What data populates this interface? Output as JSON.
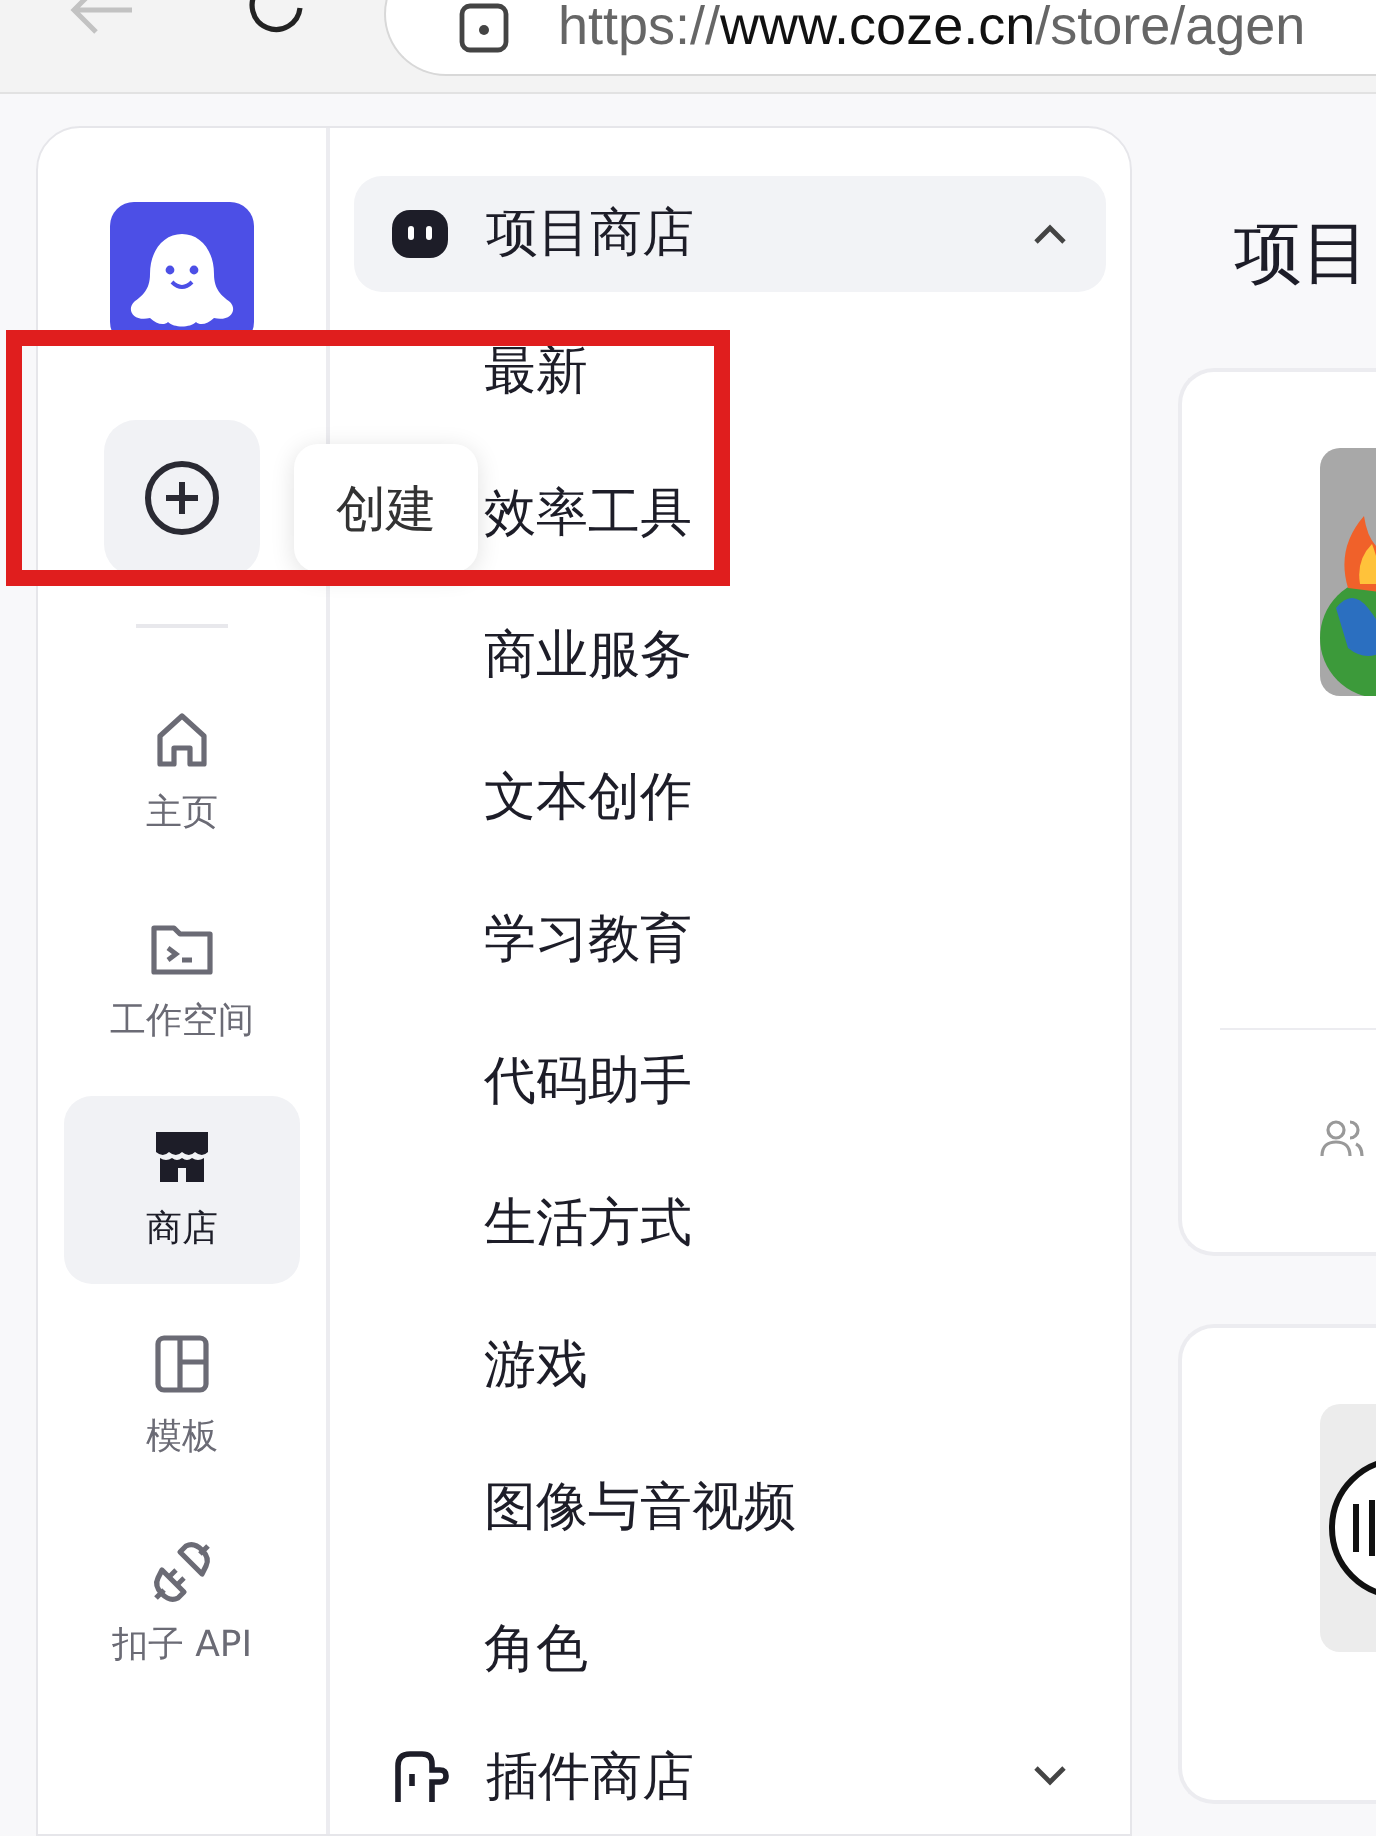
{
  "browser": {
    "url_scheme": "https://",
    "url_host": "www.coze.cn",
    "url_path": "/store/agen"
  },
  "rail": {
    "create": {
      "tooltip": "创建"
    },
    "items": [
      {
        "kind": "home",
        "label": "主页",
        "selected": false
      },
      {
        "kind": "workspace",
        "label": "工作空间",
        "selected": false
      },
      {
        "kind": "store",
        "label": "商店",
        "selected": true
      },
      {
        "kind": "template",
        "label": "模板",
        "selected": false
      },
      {
        "kind": "api",
        "label": "扣子 API",
        "selected": false
      }
    ]
  },
  "menu": {
    "sections": [
      {
        "kind": "project",
        "label": "项目商店",
        "expanded": true,
        "items": [
          "最新",
          "效率工具",
          "商业服务",
          "文本创作",
          "学习教育",
          "代码助手",
          "生活方式",
          "游戏",
          "图像与音视频",
          "角色"
        ]
      },
      {
        "kind": "plugin",
        "label": "插件商店",
        "expanded": false
      }
    ]
  },
  "content": {
    "title": "项目"
  }
}
